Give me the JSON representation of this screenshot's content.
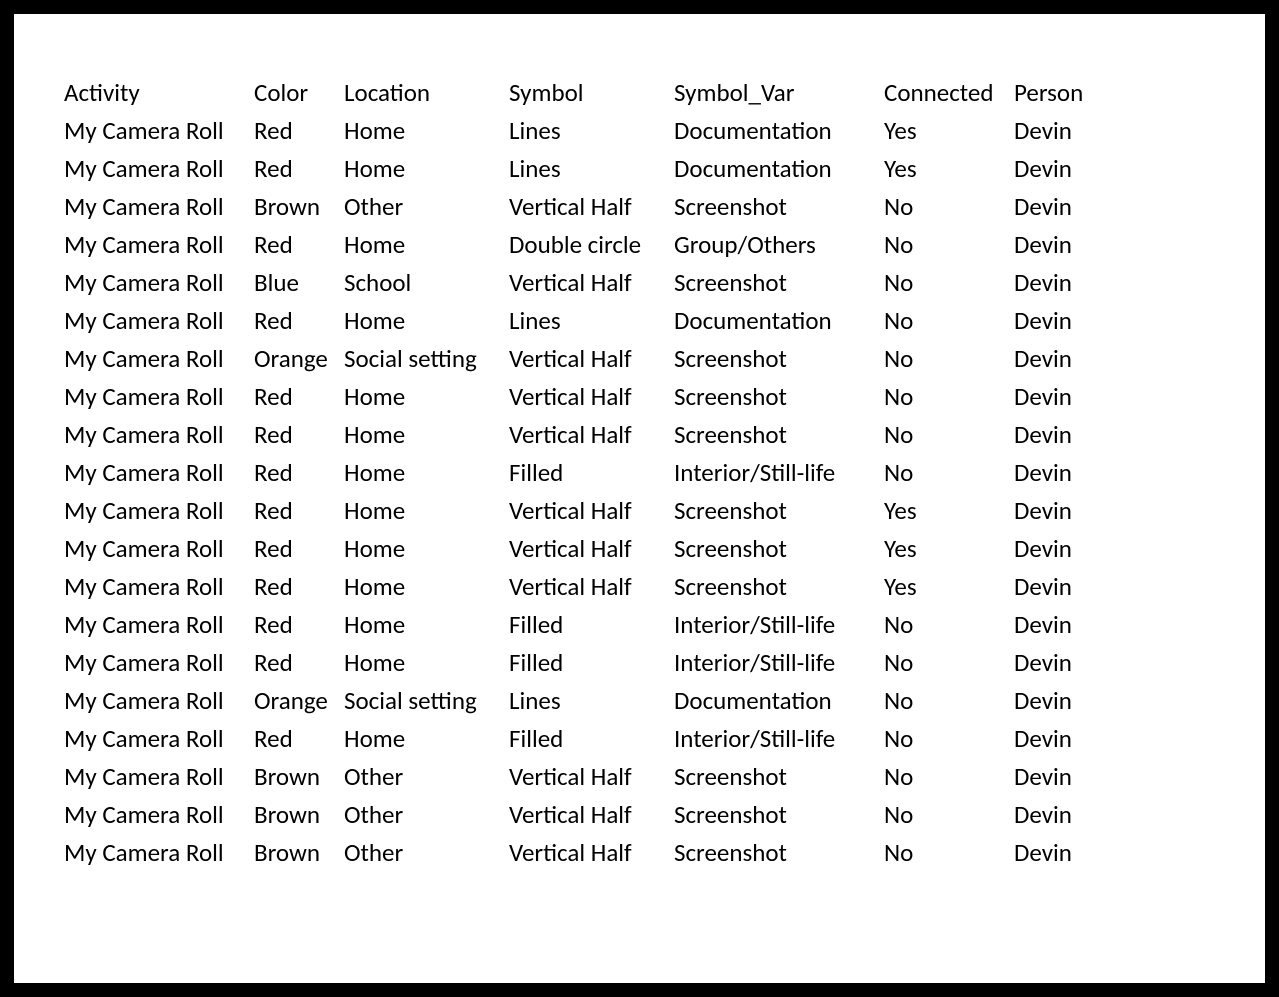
{
  "table": {
    "headers": [
      "Activity",
      "Color",
      "Location",
      "Symbol",
      "Symbol_Var",
      "Connected",
      "Person"
    ],
    "rows": [
      [
        "My Camera Roll",
        "Red",
        "Home",
        "Lines",
        "Documentation",
        "Yes",
        "Devin"
      ],
      [
        "My Camera Roll",
        "Red",
        "Home",
        "Lines",
        "Documentation",
        "Yes",
        "Devin"
      ],
      [
        "My Camera Roll",
        "Brown",
        "Other",
        "Vertical Half",
        "Screenshot",
        "No",
        "Devin"
      ],
      [
        "My Camera Roll",
        "Red",
        "Home",
        "Double circle",
        "Group/Others",
        "No",
        "Devin"
      ],
      [
        "My Camera Roll",
        "Blue",
        "School",
        "Vertical Half",
        "Screenshot",
        "No",
        "Devin"
      ],
      [
        "My Camera Roll",
        "Red",
        "Home",
        "Lines",
        "Documentation",
        "No",
        "Devin"
      ],
      [
        "My Camera Roll",
        "Orange",
        "Social setting",
        "Vertical Half",
        "Screenshot",
        "No",
        "Devin"
      ],
      [
        "My Camera Roll",
        "Red",
        "Home",
        "Vertical Half",
        "Screenshot",
        "No",
        "Devin"
      ],
      [
        "My Camera Roll",
        "Red",
        "Home",
        "Vertical Half",
        "Screenshot",
        "No",
        "Devin"
      ],
      [
        "My Camera Roll",
        "Red",
        "Home",
        "Filled",
        "Interior/Still-life",
        "No",
        "Devin"
      ],
      [
        "My Camera Roll",
        "Red",
        "Home",
        "Vertical Half",
        "Screenshot",
        "Yes",
        "Devin"
      ],
      [
        "My Camera Roll",
        "Red",
        "Home",
        "Vertical Half",
        "Screenshot",
        "Yes",
        "Devin"
      ],
      [
        "My Camera Roll",
        "Red",
        "Home",
        "Vertical Half",
        "Screenshot",
        "Yes",
        "Devin"
      ],
      [
        "My Camera Roll",
        "Red",
        "Home",
        "Filled",
        "Interior/Still-life",
        "No",
        "Devin"
      ],
      [
        "My Camera Roll",
        "Red",
        "Home",
        "Filled",
        "Interior/Still-life",
        "No",
        "Devin"
      ],
      [
        "My Camera Roll",
        "Orange",
        "Social setting",
        "Lines",
        "Documentation",
        "No",
        "Devin"
      ],
      [
        "My Camera Roll",
        "Red",
        "Home",
        "Filled",
        "Interior/Still-life",
        "No",
        "Devin"
      ],
      [
        "My Camera Roll",
        "Brown",
        "Other",
        "Vertical Half",
        "Screenshot",
        "No",
        "Devin"
      ],
      [
        "My Camera Roll",
        "Brown",
        "Other",
        "Vertical Half",
        "Screenshot",
        "No",
        "Devin"
      ],
      [
        "My Camera Roll",
        "Brown",
        "Other",
        "Vertical Half",
        "Screenshot",
        "No",
        "Devin"
      ]
    ]
  }
}
